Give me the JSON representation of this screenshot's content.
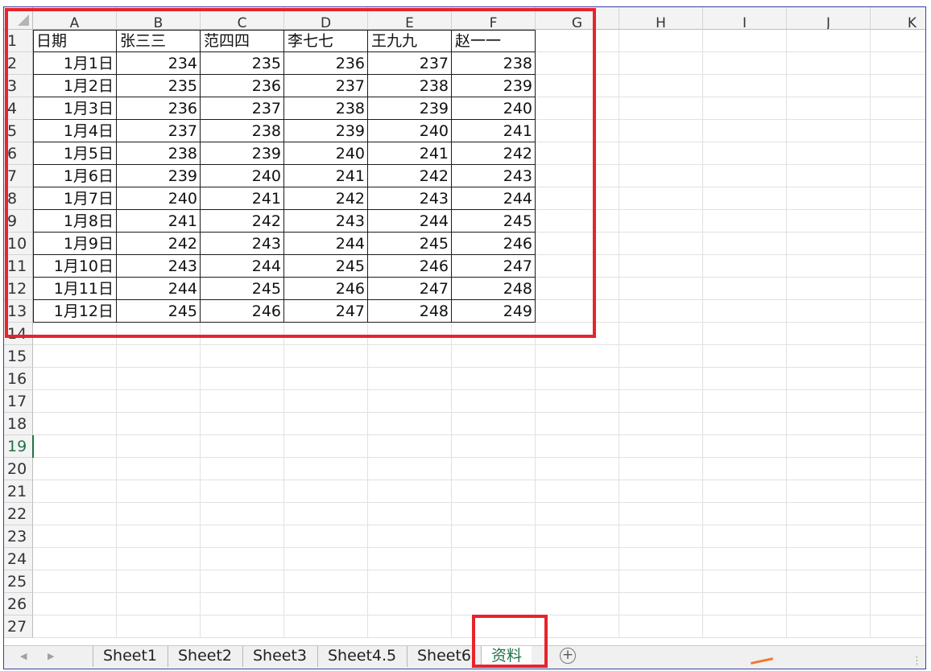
{
  "colors": {
    "annotation_red": "#e8232c",
    "excel_green": "#217346",
    "header_bg": "#f3f3f3",
    "gridline": "#e1e1e1"
  },
  "columns": [
    "A",
    "B",
    "C",
    "D",
    "E",
    "F",
    "G",
    "H",
    "I",
    "J",
    "K"
  ],
  "rows": [
    "1",
    "2",
    "3",
    "4",
    "5",
    "6",
    "7",
    "8",
    "9",
    "10",
    "11",
    "12",
    "13",
    "14",
    "15",
    "16",
    "17",
    "18",
    "19",
    "20",
    "21",
    "22",
    "23",
    "24",
    "25",
    "26",
    "27"
  ],
  "selected_row": "19",
  "table": {
    "headers": [
      "日期",
      "张三三",
      "范四四",
      "李七七",
      "王九九",
      "赵一一"
    ],
    "rows": [
      [
        "1月1日",
        "234",
        "235",
        "236",
        "237",
        "238"
      ],
      [
        "1月2日",
        "235",
        "236",
        "237",
        "238",
        "239"
      ],
      [
        "1月3日",
        "236",
        "237",
        "238",
        "239",
        "240"
      ],
      [
        "1月4日",
        "237",
        "238",
        "239",
        "240",
        "241"
      ],
      [
        "1月5日",
        "238",
        "239",
        "240",
        "241",
        "242"
      ],
      [
        "1月6日",
        "239",
        "240",
        "241",
        "242",
        "243"
      ],
      [
        "1月7日",
        "240",
        "241",
        "242",
        "243",
        "244"
      ],
      [
        "1月8日",
        "241",
        "242",
        "243",
        "244",
        "245"
      ],
      [
        "1月9日",
        "242",
        "243",
        "244",
        "245",
        "246"
      ],
      [
        "1月10日",
        "243",
        "244",
        "245",
        "246",
        "247"
      ],
      [
        "1月11日",
        "244",
        "245",
        "246",
        "247",
        "248"
      ],
      [
        "1月12日",
        "245",
        "246",
        "247",
        "248",
        "249"
      ]
    ]
  },
  "sheet_tabs": [
    {
      "label": "Sheet1",
      "active": false
    },
    {
      "label": "Sheet2",
      "active": false
    },
    {
      "label": "Sheet3",
      "active": false
    },
    {
      "label": "Sheet4.5",
      "active": false
    },
    {
      "label": "Sheet6",
      "active": false
    },
    {
      "label": "资料",
      "active": true
    }
  ],
  "icons": {
    "prev_sheet": "◀",
    "next_sheet": "▶",
    "add_sheet": "+"
  }
}
